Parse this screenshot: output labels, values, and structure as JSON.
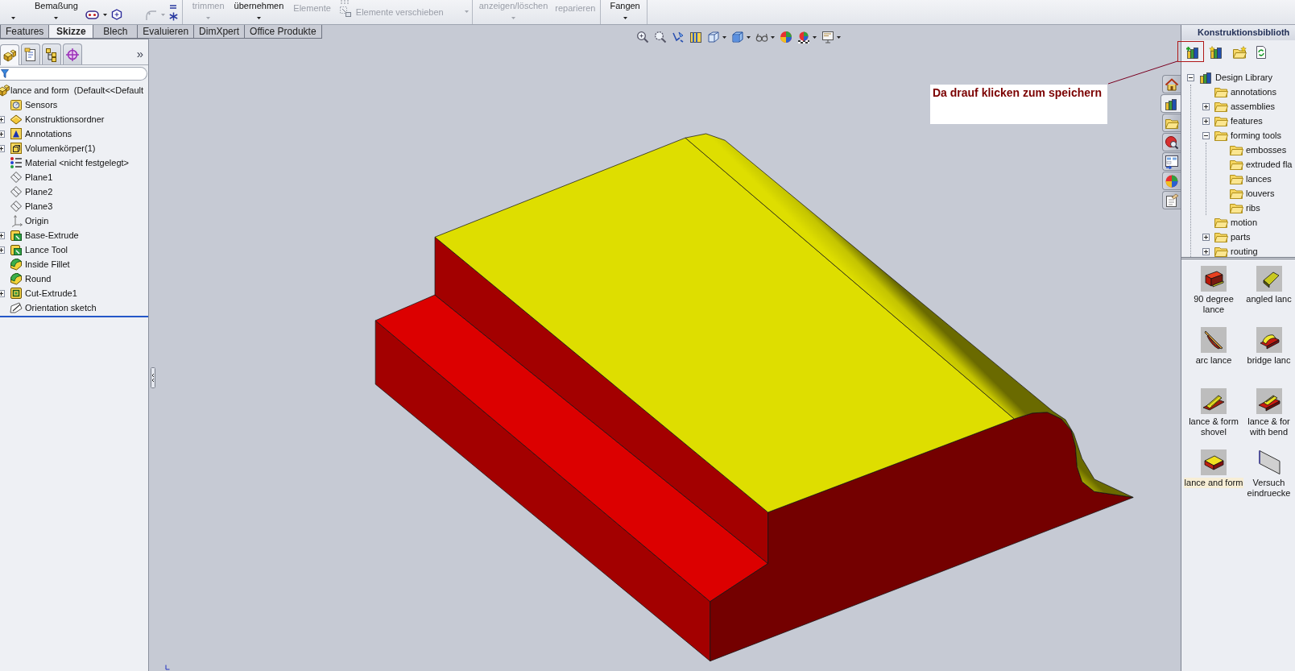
{
  "command_manager": [
    {
      "items": [
        {
          "kind": "caret"
        },
        {
          "kind": "stacked",
          "label": "Bemaßung",
          "disabled": false,
          "dropdown": true
        },
        {
          "kind": "sketch-tools"
        }
      ]
    },
    {
      "items": [
        {
          "kind": "stacked",
          "label": "trimmen",
          "disabled": true,
          "dropdown": true
        },
        {
          "kind": "stacked",
          "label": "übernehmen",
          "disabled": false,
          "dropdown": true
        },
        {
          "kind": "stacked",
          "label": "Elemente",
          "disabled": true,
          "dropdown": false
        },
        {
          "kind": "inline",
          "label": "Elemente verschieben",
          "disabled": true,
          "dropdown": true
        }
      ]
    },
    {
      "items": [
        {
          "kind": "stacked",
          "label": "anzeigen/löschen",
          "disabled": true,
          "dropdown": true
        },
        {
          "kind": "stacked",
          "label": "reparieren",
          "disabled": true,
          "dropdown": false
        }
      ]
    },
    {
      "items": [
        {
          "kind": "stacked",
          "label": "Fangen",
          "disabled": false,
          "dropdown": true
        }
      ]
    }
  ],
  "tabs": [
    {
      "label": "Features",
      "selected": false
    },
    {
      "label": "Skizze",
      "selected": true
    },
    {
      "label": "Blech",
      "selected": false
    },
    {
      "label": "Evaluieren",
      "selected": false
    },
    {
      "label": "DimXpert",
      "selected": false
    },
    {
      "label": "Office Produkte",
      "selected": false
    }
  ],
  "feature_manager": {
    "tabs": [
      {
        "kind": "features",
        "selected": true
      },
      {
        "kind": "properties",
        "selected": false
      },
      {
        "kind": "configurations",
        "selected": false
      },
      {
        "kind": "dimxpert",
        "selected": false
      }
    ],
    "more": "»",
    "tree": {
      "kind": "part",
      "label": "lance and form  (Default<<Default",
      "children": [
        {
          "kind": "sensors",
          "label": "Sensors"
        },
        {
          "kind": "design-folder",
          "label": "Konstruktionsordner",
          "expanded": false
        },
        {
          "kind": "annotations",
          "label": "Annotations",
          "expanded": false
        },
        {
          "kind": "solid-bodies",
          "label": "Volumenkörper(1)",
          "expanded": false
        },
        {
          "kind": "material",
          "label": "Material <nicht festgelegt>"
        },
        {
          "kind": "plane",
          "label": "Plane1"
        },
        {
          "kind": "plane",
          "label": "Plane2"
        },
        {
          "kind": "plane",
          "label": "Plane3"
        },
        {
          "kind": "origin",
          "label": "Origin"
        },
        {
          "kind": "extrude",
          "label": "Base-Extrude",
          "expanded": false
        },
        {
          "kind": "extrude",
          "label": "Lance Tool",
          "expanded": false
        },
        {
          "kind": "fillet",
          "label": "Inside Fillet"
        },
        {
          "kind": "fillet",
          "label": "Round"
        },
        {
          "kind": "cut-extrude",
          "label": "Cut-Extrude1",
          "expanded": false
        },
        {
          "kind": "sketch",
          "label": "Orientation sketch"
        }
      ]
    }
  },
  "annotation": {
    "text": "Da drauf klicken zum speichern"
  },
  "task_pane": {
    "tabs": [
      {
        "kind": "home",
        "selected": false
      },
      {
        "kind": "design-library",
        "selected": true
      },
      {
        "kind": "file-explorer",
        "selected": false
      },
      {
        "kind": "search",
        "selected": false
      },
      {
        "kind": "custom-properties",
        "selected": false
      },
      {
        "kind": "appearances",
        "selected": false
      },
      {
        "kind": "document",
        "selected": false
      }
    ],
    "title": "Konstruktionsbiblioth",
    "tree": {
      "kind": "library",
      "label": "Design Library",
      "expanded": true,
      "children": [
        {
          "kind": "folder",
          "label": "annotations"
        },
        {
          "kind": "folder",
          "label": "assemblies",
          "expanded": false
        },
        {
          "kind": "folder",
          "label": "features",
          "expanded": false
        },
        {
          "kind": "folder",
          "label": "forming tools",
          "expanded": true,
          "children": [
            {
              "kind": "folder",
              "label": "embosses"
            },
            {
              "kind": "folder",
              "label": "extruded fla"
            },
            {
              "kind": "folder",
              "label": "lances"
            },
            {
              "kind": "folder",
              "label": "louvers"
            },
            {
              "kind": "folder",
              "label": "ribs"
            }
          ]
        },
        {
          "kind": "folder",
          "label": "motion"
        },
        {
          "kind": "folder",
          "label": "parts",
          "expanded": false
        },
        {
          "kind": "folder",
          "label": "routing",
          "expanded": false
        }
      ]
    },
    "items": [
      {
        "kind": "block",
        "label": "90 degree\nlance",
        "selected": false
      },
      {
        "kind": "wedge",
        "label": "angled lanc",
        "selected": false
      },
      {
        "kind": "blade",
        "label": "arc lance",
        "selected": false
      },
      {
        "kind": "bridge",
        "label": "bridge lanc",
        "selected": false
      },
      {
        "kind": "ribbed",
        "label": "lance & form\nshovel",
        "selected": false
      },
      {
        "kind": "bent",
        "label": "lance & for\nwith bend",
        "selected": false
      },
      {
        "kind": "slab",
        "label": "lance and form",
        "selected": true
      },
      {
        "kind": "plate",
        "label": "Versuch\neindruecke",
        "selected": false
      }
    ]
  }
}
